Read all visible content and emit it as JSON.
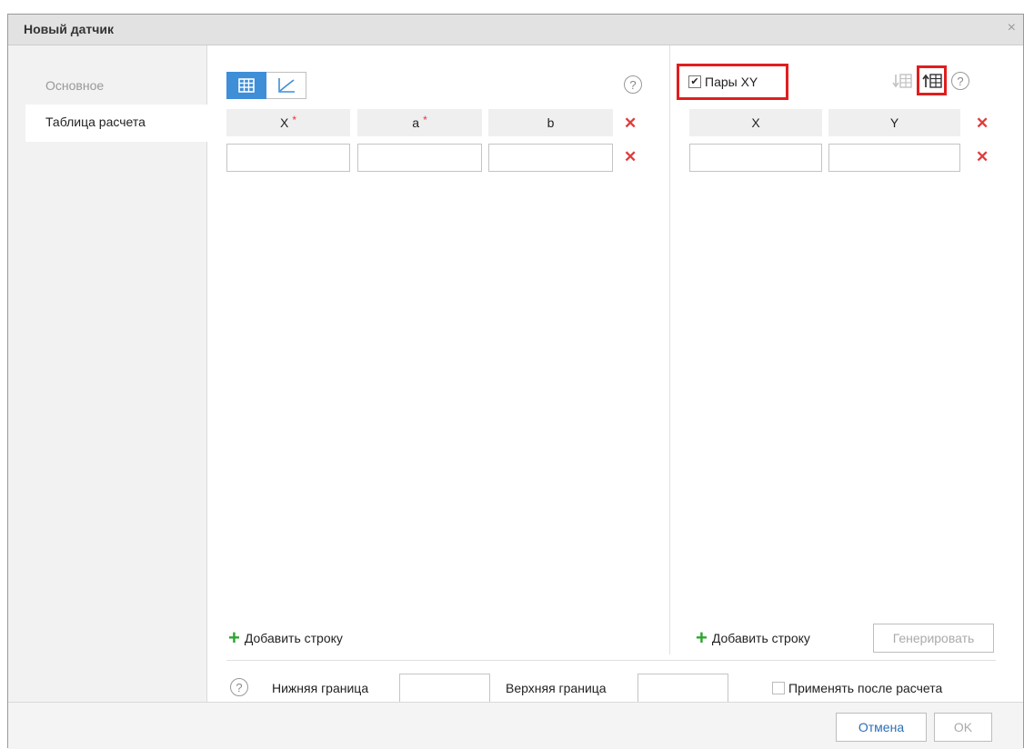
{
  "dialog": {
    "title": "Новый датчик",
    "close_glyph": "×"
  },
  "sidebar": {
    "items": [
      {
        "label": "Основное"
      },
      {
        "label": "Таблица расчета"
      }
    ]
  },
  "left_table": {
    "columns": [
      {
        "label": "X",
        "required": "*"
      },
      {
        "label": "a",
        "required": "*"
      },
      {
        "label": "b"
      }
    ],
    "row_values": [
      "",
      "",
      ""
    ],
    "add_row": "Добавить строку",
    "help": "?"
  },
  "right_table": {
    "xy_pairs_label": "Пары XY",
    "xy_pairs_checked": true,
    "columns": [
      "X",
      "Y"
    ],
    "row_values": [
      "",
      ""
    ],
    "add_row": "Добавить строку",
    "generate": "Генерировать",
    "help": "?"
  },
  "bounds": {
    "help": "?",
    "lower_label": "Нижняя граница",
    "lower_value": "",
    "upper_label": "Верхняя граница",
    "upper_value": "",
    "apply_label": "Применять после расчета",
    "apply_checked": false
  },
  "footer": {
    "cancel": "Отмена",
    "ok": "OK"
  },
  "colors": {
    "accent": "#3f8ed8",
    "delete": "#e23b3b",
    "add": "#2fa52f",
    "highlight": "#e01e1e"
  },
  "icons": {
    "table_mode": "table-icon",
    "graph_mode": "graph-icon",
    "delete": "delete-x-icon",
    "add": "plus-icon",
    "insert_below": "insert-row-below-icon",
    "insert_above": "insert-row-above-icon"
  }
}
